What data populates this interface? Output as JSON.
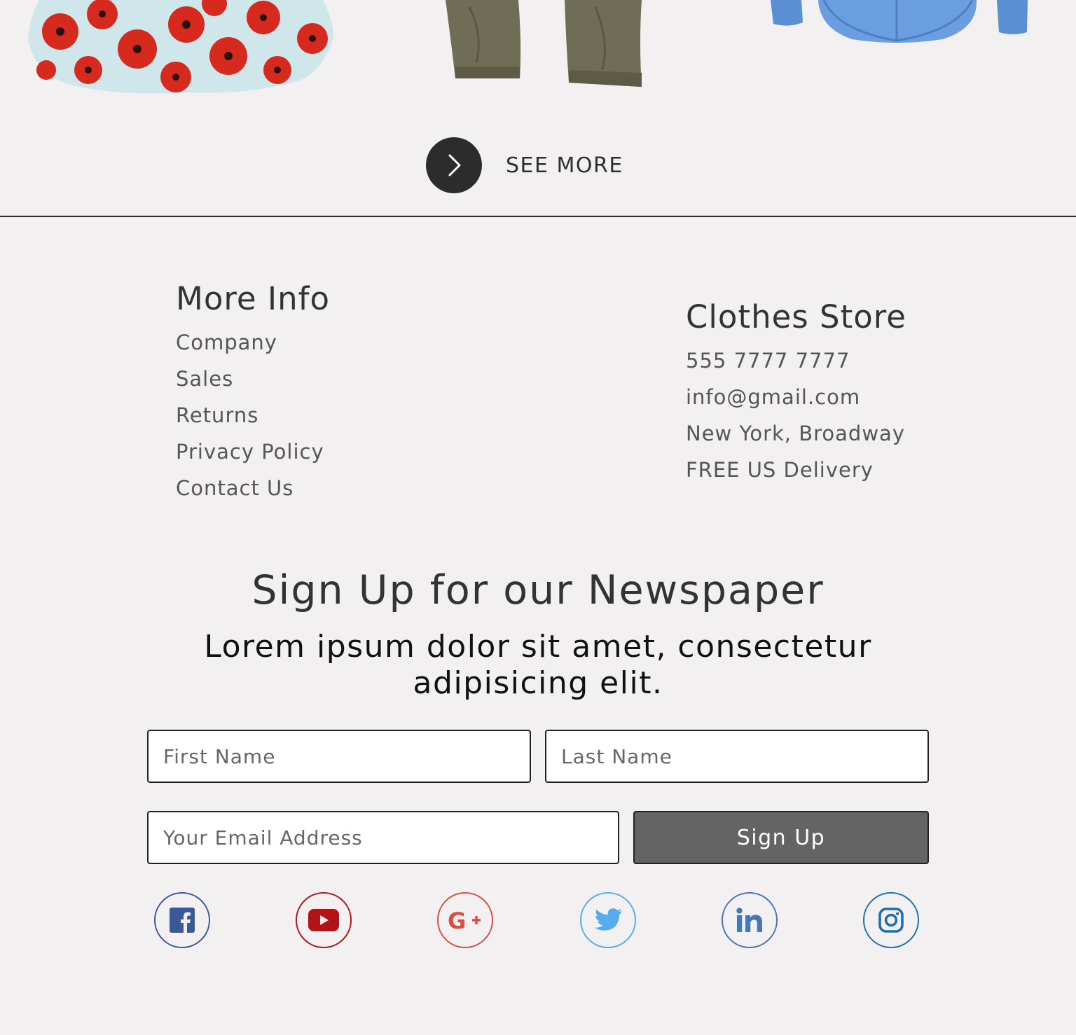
{
  "see_more": {
    "label": "SEE MORE"
  },
  "more_info": {
    "title": "More Info",
    "links": [
      "Company",
      "Sales",
      "Returns",
      "Privacy Policy",
      "Contact Us"
    ]
  },
  "store": {
    "title": "Clothes Store",
    "phone": "555 7777 7777",
    "email": "info@gmail.com",
    "address": "New York, Broadway",
    "delivery": "FREE US Delivery"
  },
  "newsletter": {
    "title": "Sign Up for our Newspaper",
    "subtitle": "Lorem ipsum dolor sit amet, consectetur adipisicing elit.",
    "first_name_placeholder": "First Name",
    "last_name_placeholder": "Last Name",
    "email_placeholder": "Your Email Address",
    "button_label": "Sign Up"
  },
  "social": [
    {
      "name": "facebook-icon",
      "color": "#3b5998"
    },
    {
      "name": "youtube-icon",
      "color": "#b31217"
    },
    {
      "name": "google-plus-icon",
      "color": "#dc4e41"
    },
    {
      "name": "twitter-icon",
      "color": "#55acee"
    },
    {
      "name": "linkedin-icon",
      "color": "#4875b4"
    },
    {
      "name": "instagram-icon",
      "color": "#1f6fae"
    }
  ],
  "products": [
    {
      "name": "floral-skirt-image",
      "description_color": "#d9201c"
    },
    {
      "name": "olive-trousers-image",
      "description_color": "#6f6d55"
    },
    {
      "name": "blue-shirt-image",
      "description_color": "#5b8fd4"
    }
  ]
}
